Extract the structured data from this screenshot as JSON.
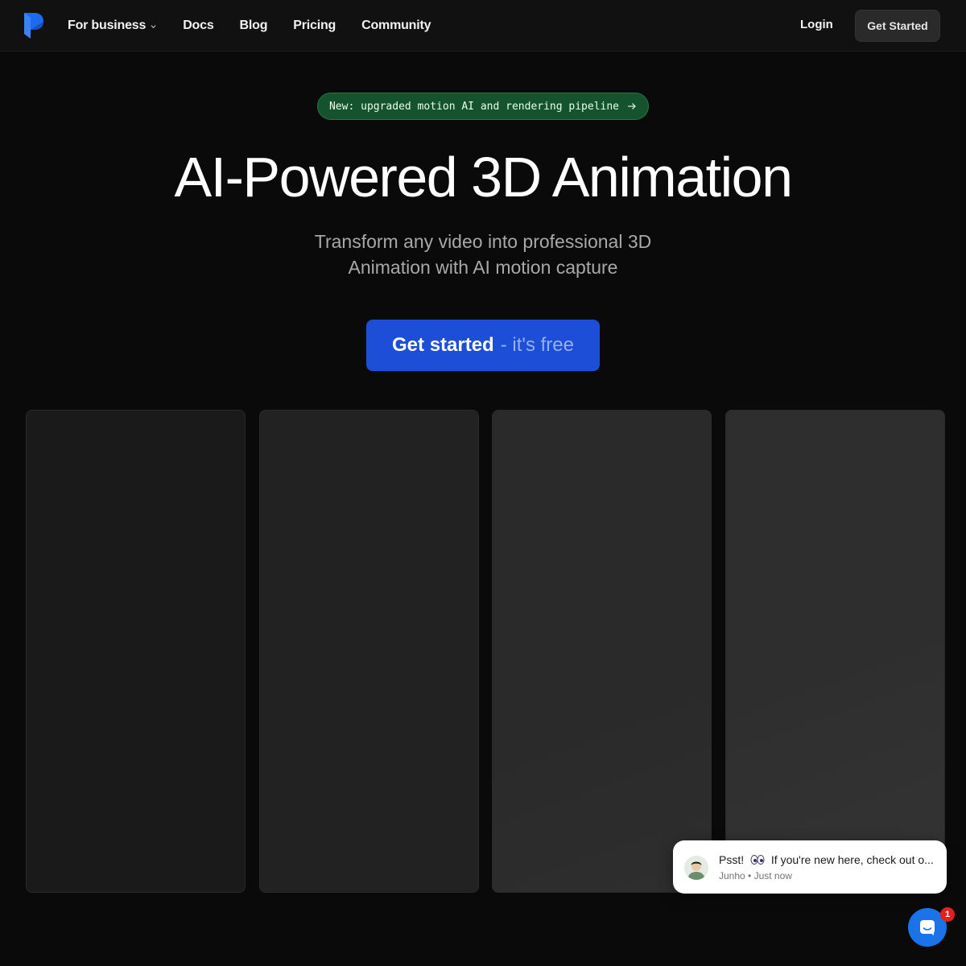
{
  "nav": {
    "links": [
      {
        "label": "For business",
        "has_dropdown": true
      },
      {
        "label": "Docs"
      },
      {
        "label": "Blog"
      },
      {
        "label": "Pricing"
      },
      {
        "label": "Community"
      }
    ],
    "login_label": "Login",
    "cta_label": "Get Started",
    "logo_icon": "brand-logo-icon",
    "brand_color": "#1d6cf0"
  },
  "hero": {
    "announcement": "New: upgraded motion AI and rendering pipeline",
    "title": "AI-Powered 3D Animation",
    "subtitle_line1": "Transform any video into professional 3D",
    "subtitle_line2": "Animation with AI motion capture",
    "cta_main": "Get started",
    "cta_suffix": "- it's free",
    "cta_color": "#1d4ed8"
  },
  "chat": {
    "message_prefix": "Psst!",
    "message_text": "If you're new here, check out o...",
    "author": "Junho",
    "time": "Just now",
    "badge_count": "1",
    "launcher_icon": "chat-icon"
  }
}
